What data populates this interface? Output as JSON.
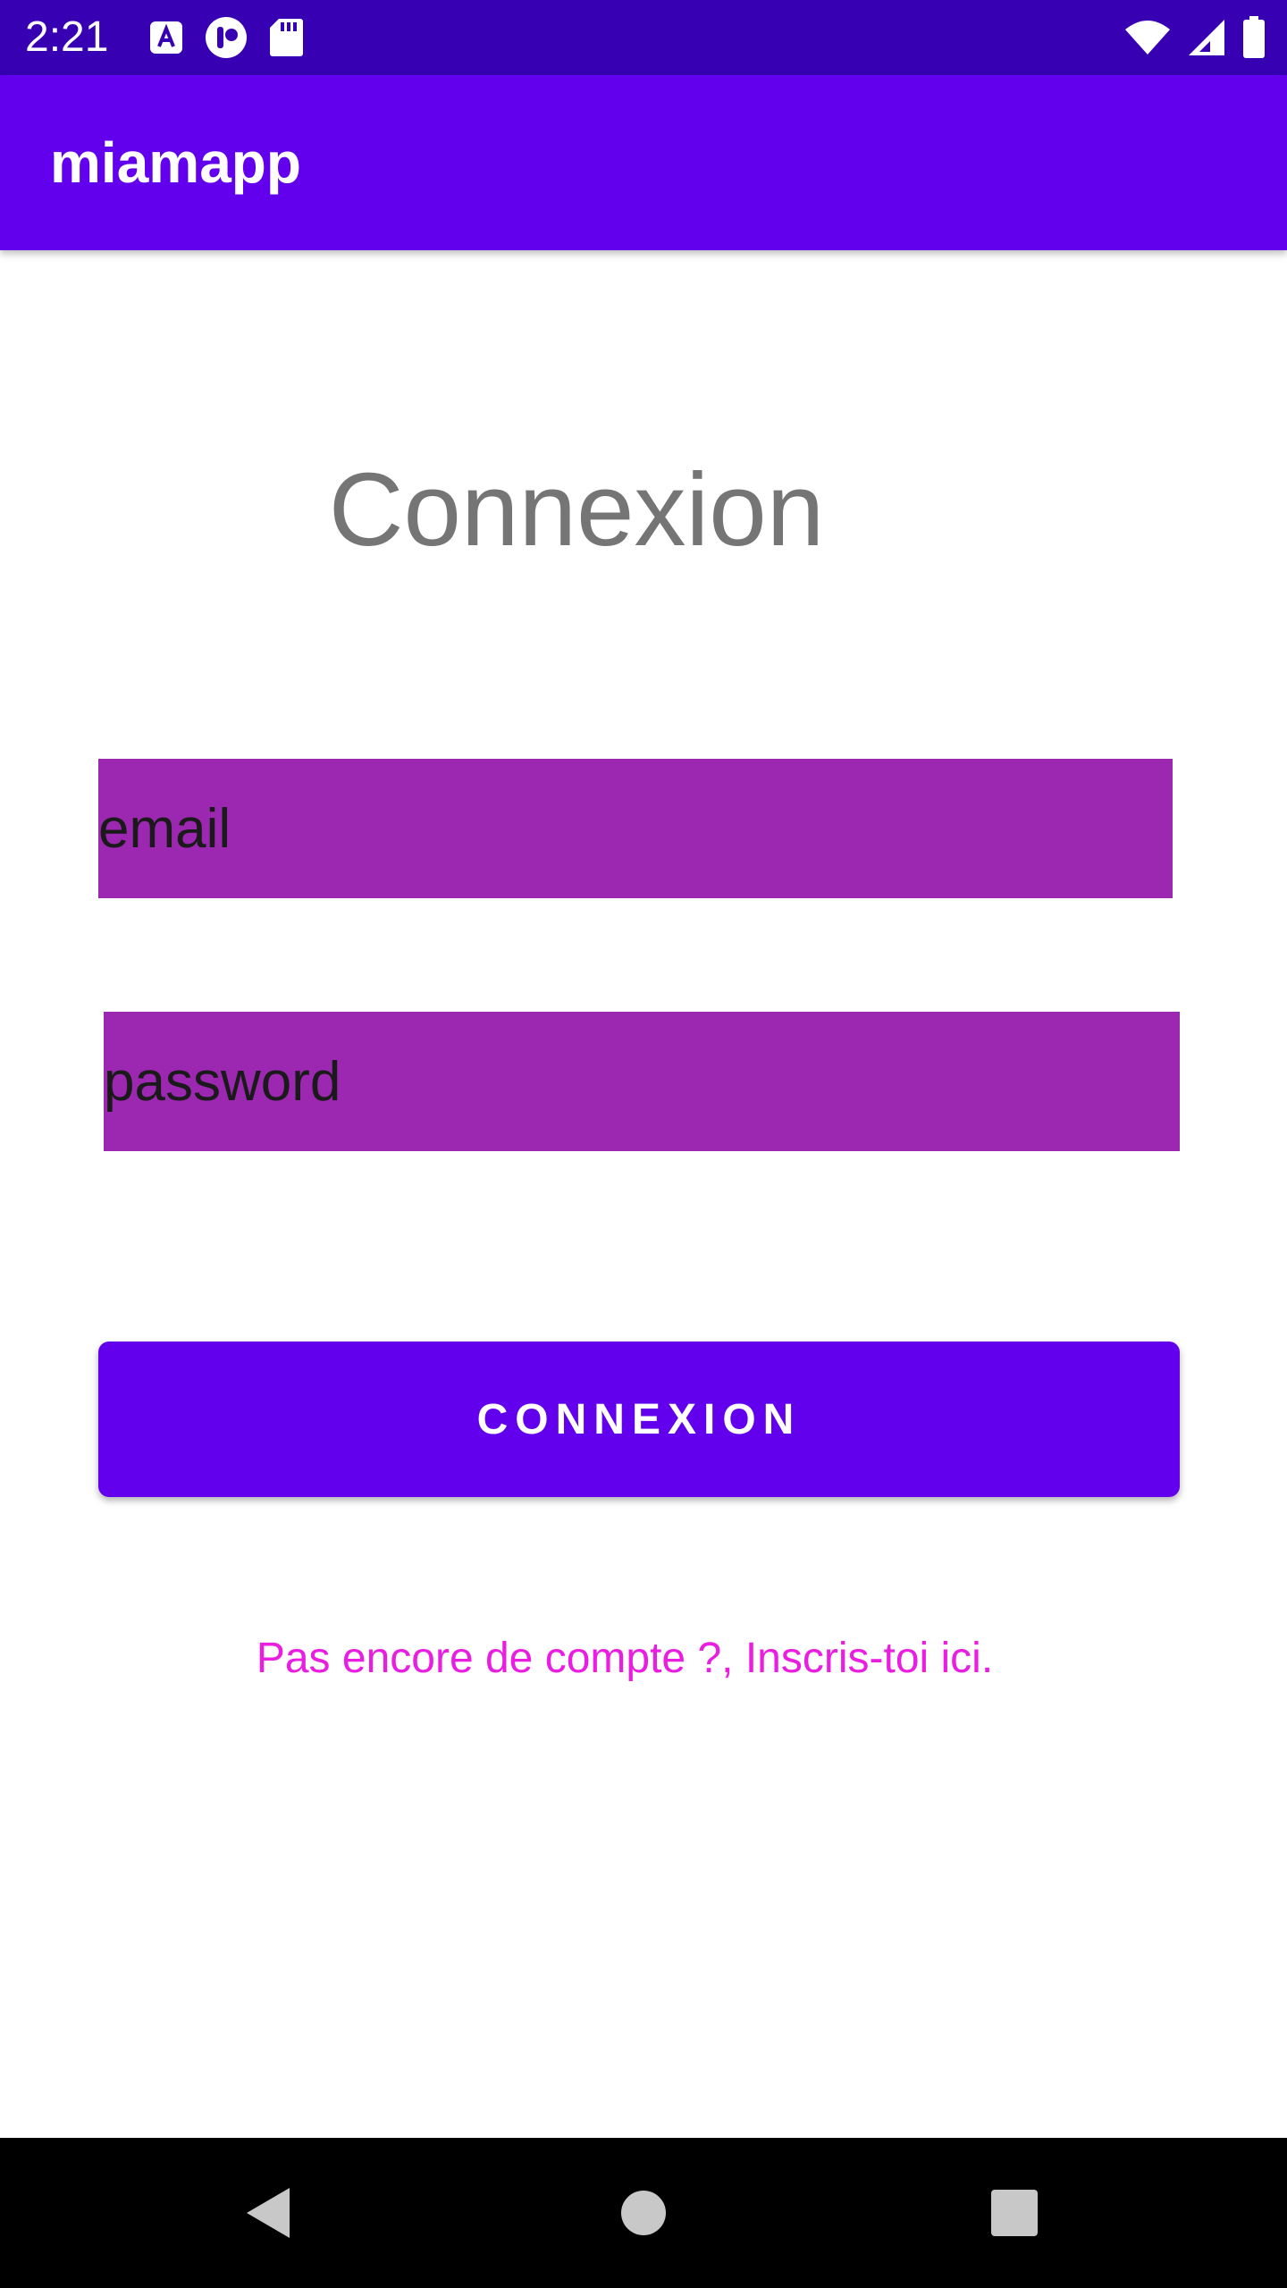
{
  "status_bar": {
    "time": "2:21",
    "background": "#3700B3",
    "left_icons": [
      "accessibility-font-icon",
      "notification-app-icon",
      "sd-card-icon"
    ],
    "right_icons": [
      "wifi-icon",
      "signal-icon",
      "battery-icon"
    ]
  },
  "app_bar": {
    "title": "miamapp",
    "background": "#6200EE"
  },
  "login": {
    "heading": "Connexion",
    "email_placeholder": "email",
    "email_value": "",
    "password_placeholder": "password",
    "password_value": "",
    "field_color": "#9C27B0",
    "submit_label": "CONNEXION",
    "submit_color": "#6200EE",
    "signup_text": "Pas encore de compte ?, Inscris-toi ici.",
    "signup_color": "#E91EE0"
  },
  "nav_bar": {
    "buttons": [
      "back-icon",
      "home-icon",
      "recents-icon"
    ]
  }
}
